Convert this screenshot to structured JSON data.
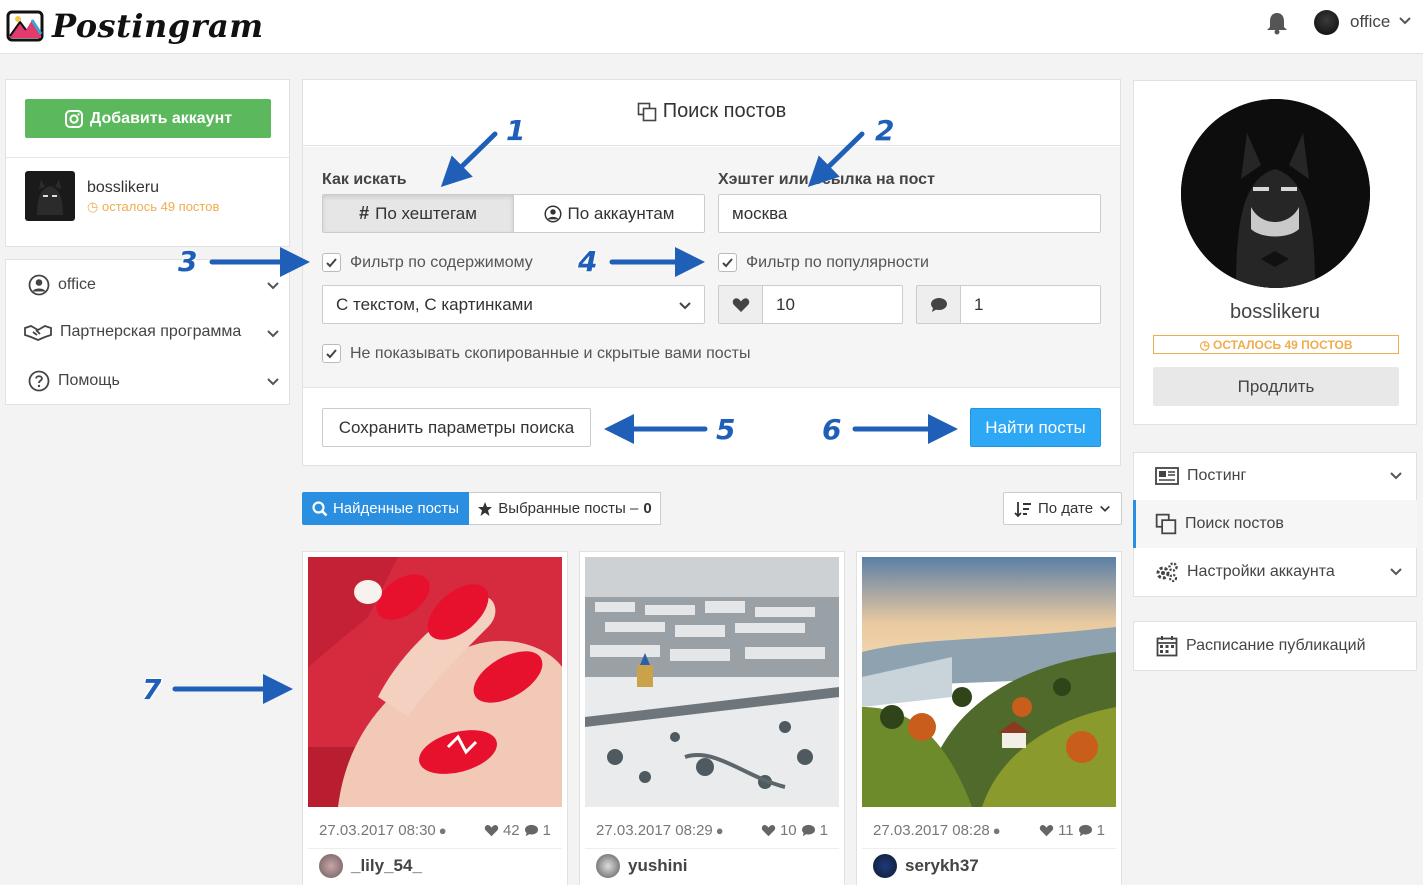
{
  "app": {
    "name": "Postingram"
  },
  "topbar": {
    "user": "office"
  },
  "left": {
    "add_account": "Добавить аккаунт",
    "account": {
      "name": "bosslikeru",
      "posts_left": "осталось 49 постов"
    },
    "menu": [
      {
        "label": "office",
        "icon": "user-circle-icon"
      },
      {
        "label": "Партнерская программа",
        "icon": "handshake-icon"
      },
      {
        "label": "Помощь",
        "icon": "question-circle-icon"
      }
    ]
  },
  "search": {
    "title": "Поиск постов",
    "how_label": "Как искать",
    "mode_hashtag": "По хештегам",
    "mode_accounts": "По аккаунтам",
    "hashtag_label": "Хэштег или ссылка на пост",
    "hashtag_value": "москва",
    "filter_content": "Фильтр по содержимому",
    "filter_popularity": "Фильтр по популярности",
    "content_select": "С текстом, С картинками",
    "likes_min": "10",
    "comments_min": "1",
    "hide_copied": "Не показывать скопированные и скрытые вами посты",
    "save_params": "Сохранить параметры поиска",
    "find": "Найти посты"
  },
  "annotations": [
    "1",
    "2",
    "3",
    "4",
    "5",
    "6",
    "7"
  ],
  "tabs": {
    "found": "Найденные посты",
    "selected": "Выбранные посты – ",
    "selected_count": "0",
    "sort": "По дате"
  },
  "posts": [
    {
      "date": "27.03.2017 08:30",
      "likes": "42",
      "comments": "1",
      "user": "_lily_54_"
    },
    {
      "date": "27.03.2017 08:29",
      "likes": "10",
      "comments": "1",
      "user": "yushini"
    },
    {
      "date": "27.03.2017 08:28",
      "likes": "11",
      "comments": "1",
      "user": "serykh37"
    }
  ],
  "profile": {
    "name": "bosslikeru",
    "badge": "ОСТАЛОСЬ 49 ПОСТОВ",
    "renew": "Продлить"
  },
  "right_nav": [
    {
      "label": "Постинг",
      "icon": "newspaper-icon"
    },
    {
      "label": "Поиск постов",
      "icon": "copy-icon"
    },
    {
      "label": "Настройки аккаунта",
      "icon": "cogs-icon"
    }
  ],
  "schedule": "Расписание публикаций",
  "colors": {
    "primary": "#2ea8f5",
    "success": "#5cb85c",
    "warning": "#f0ad4e",
    "annotation": "#1f5fb8"
  }
}
